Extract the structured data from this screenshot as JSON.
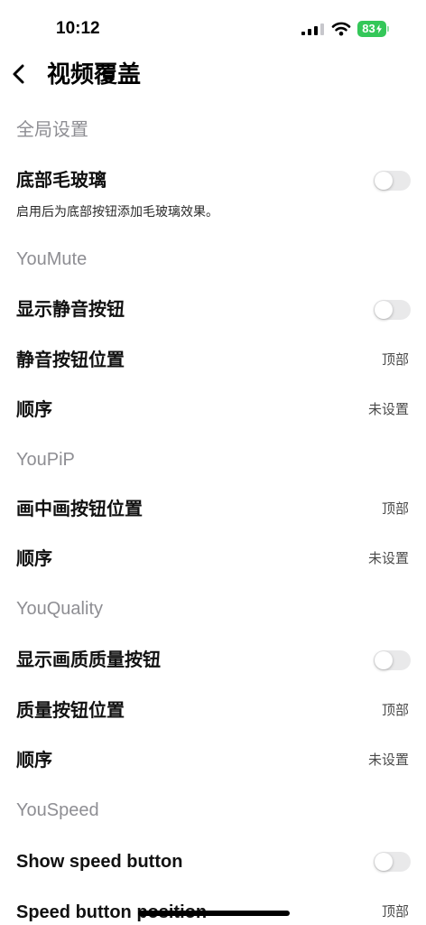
{
  "status_bar": {
    "time": "10:12",
    "battery": "83",
    "charging": true
  },
  "icons": {
    "signal": "cellular-signal-icon",
    "wifi": "wifi-icon",
    "battery": "battery-icon",
    "charging": "charging-bolt-icon",
    "back": "chevron-left-icon"
  },
  "colors": {
    "text": "#000000",
    "battery": "#34c759",
    "section_header": "#8e8e93",
    "toggle_track_off": "#e9e9ea",
    "toggle_on": "#34c759"
  },
  "nav": {
    "title": "视频覆盖"
  },
  "sections": [
    {
      "header": "全局设置",
      "rows": [
        {
          "label": "底部毛玻璃",
          "subtitle": "启用后为底部按钮添加毛玻璃效果。",
          "toggle_on": false
        }
      ]
    },
    {
      "header": "YouMute",
      "rows": [
        {
          "label": "显示静音按钮",
          "toggle_on": false
        },
        {
          "label": "静音按钮位置",
          "value": "顶部"
        },
        {
          "label": "顺序",
          "value": "未设置"
        }
      ]
    },
    {
      "header": "YouPiP",
      "rows": [
        {
          "label": "画中画按钮位置",
          "value": "顶部"
        },
        {
          "label": "顺序",
          "value": "未设置"
        }
      ]
    },
    {
      "header": "YouQuality",
      "rows": [
        {
          "label": "显示画质质量按钮",
          "toggle_on": false
        },
        {
          "label": "质量按钮位置",
          "value": "顶部"
        },
        {
          "label": "顺序",
          "value": "未设置"
        }
      ]
    },
    {
      "header": "YouSpeed",
      "rows": [
        {
          "label": "Show speed button",
          "toggle_on": false
        },
        {
          "label": "Speed button position",
          "value": "顶部"
        }
      ]
    }
  ]
}
